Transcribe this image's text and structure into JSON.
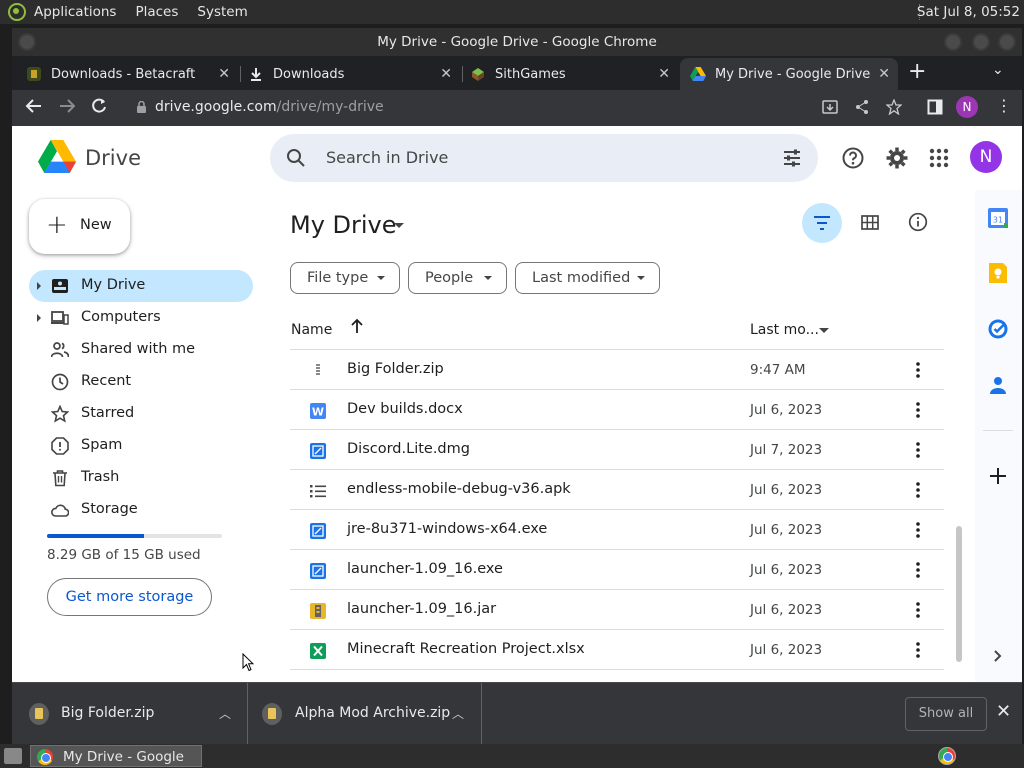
{
  "top_panel": {
    "menus": [
      "Applications",
      "Places",
      "System"
    ],
    "clock": "Sat Jul  8, 05:52"
  },
  "window": {
    "title": "My Drive - Google Drive - Google Chrome"
  },
  "tabs": [
    {
      "title": "Downloads - Betacraft",
      "icon": "betacraft-icon",
      "active": false
    },
    {
      "title": "Downloads",
      "icon": "download-icon",
      "active": false
    },
    {
      "title": "SithGames",
      "icon": "sithgames-icon",
      "active": false
    },
    {
      "title": "My Drive - Google Drive",
      "icon": "google-drive-icon",
      "active": true
    }
  ],
  "address_bar": {
    "host": "drive.google.com",
    "path": "/drive/my-drive",
    "profile_initial": "N"
  },
  "drive": {
    "app_name": "Drive",
    "search_placeholder": "Search in Drive",
    "user_initial": "N",
    "new_label": "New",
    "nav": [
      {
        "label": "My Drive",
        "icon": "my-drive-icon",
        "active": true,
        "expandable": true
      },
      {
        "label": "Computers",
        "icon": "computers-icon",
        "active": false,
        "expandable": true
      },
      {
        "label": "Shared with me",
        "icon": "shared-icon",
        "active": false,
        "expandable": false
      },
      {
        "label": "Recent",
        "icon": "clock-icon",
        "active": false,
        "expandable": false
      },
      {
        "label": "Starred",
        "icon": "star-icon",
        "active": false,
        "expandable": false
      },
      {
        "label": "Spam",
        "icon": "spam-icon",
        "active": false,
        "expandable": false
      },
      {
        "label": "Trash",
        "icon": "trash-icon",
        "active": false,
        "expandable": false
      },
      {
        "label": "Storage",
        "icon": "cloud-icon",
        "active": false,
        "expandable": false
      }
    ],
    "storage": {
      "used_fraction": 0.553,
      "text": "8.29 GB of 15 GB used",
      "cta": "Get more storage"
    },
    "main": {
      "title": "My Drive",
      "filters": [
        "File type",
        "People",
        "Last modified"
      ],
      "columns": {
        "name": "Name",
        "modified": "Last mo..."
      },
      "files": [
        {
          "name": "Big Folder.zip",
          "modified": "9:47 AM",
          "type": "zip"
        },
        {
          "name": "Dev builds.docx",
          "modified": "Jul 6, 2023",
          "type": "docx"
        },
        {
          "name": "Discord.Lite.dmg",
          "modified": "Jul 7, 2023",
          "type": "binary"
        },
        {
          "name": "endless-mobile-debug-v36.apk",
          "modified": "Jul 6, 2023",
          "type": "list"
        },
        {
          "name": "jre-8u371-windows-x64.exe",
          "modified": "Jul 6, 2023",
          "type": "binary"
        },
        {
          "name": "launcher-1.09_16.exe",
          "modified": "Jul 6, 2023",
          "type": "binary"
        },
        {
          "name": "launcher-1.09_16.jar",
          "modified": "Jul 6, 2023",
          "type": "jar"
        },
        {
          "name": "Minecraft Recreation Project.xlsx",
          "modified": "Jul 6, 2023",
          "type": "xlsx"
        }
      ]
    }
  },
  "download_shelf": {
    "items": [
      "Big Folder.zip",
      "Alpha Mod Archive.zip"
    ],
    "show_all": "Show all"
  },
  "taskbar": {
    "window_label": "My Drive - Google D..."
  },
  "colors": {
    "accent": "#0b57d0",
    "active_nav": "#c2e7ff",
    "avatar": "#9334e6"
  }
}
